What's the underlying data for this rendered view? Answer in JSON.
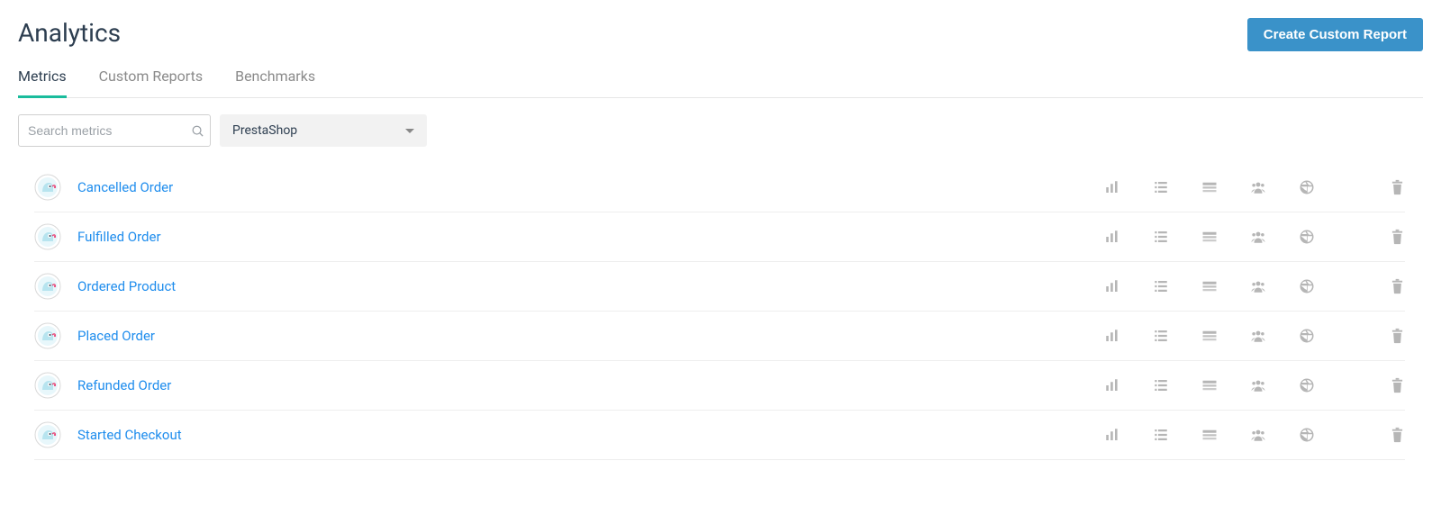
{
  "header": {
    "title": "Analytics",
    "create_button": "Create Custom Report"
  },
  "tabs": [
    {
      "label": "Metrics",
      "active": true
    },
    {
      "label": "Custom Reports",
      "active": false
    },
    {
      "label": "Benchmarks",
      "active": false
    }
  ],
  "search": {
    "placeholder": "Search metrics",
    "value": ""
  },
  "filter": {
    "selected": "PrestaShop"
  },
  "metrics": [
    {
      "name": "Cancelled Order"
    },
    {
      "name": "Fulfilled Order"
    },
    {
      "name": "Ordered Product"
    },
    {
      "name": "Placed Order"
    },
    {
      "name": "Refunded Order"
    },
    {
      "name": "Started Checkout"
    }
  ]
}
